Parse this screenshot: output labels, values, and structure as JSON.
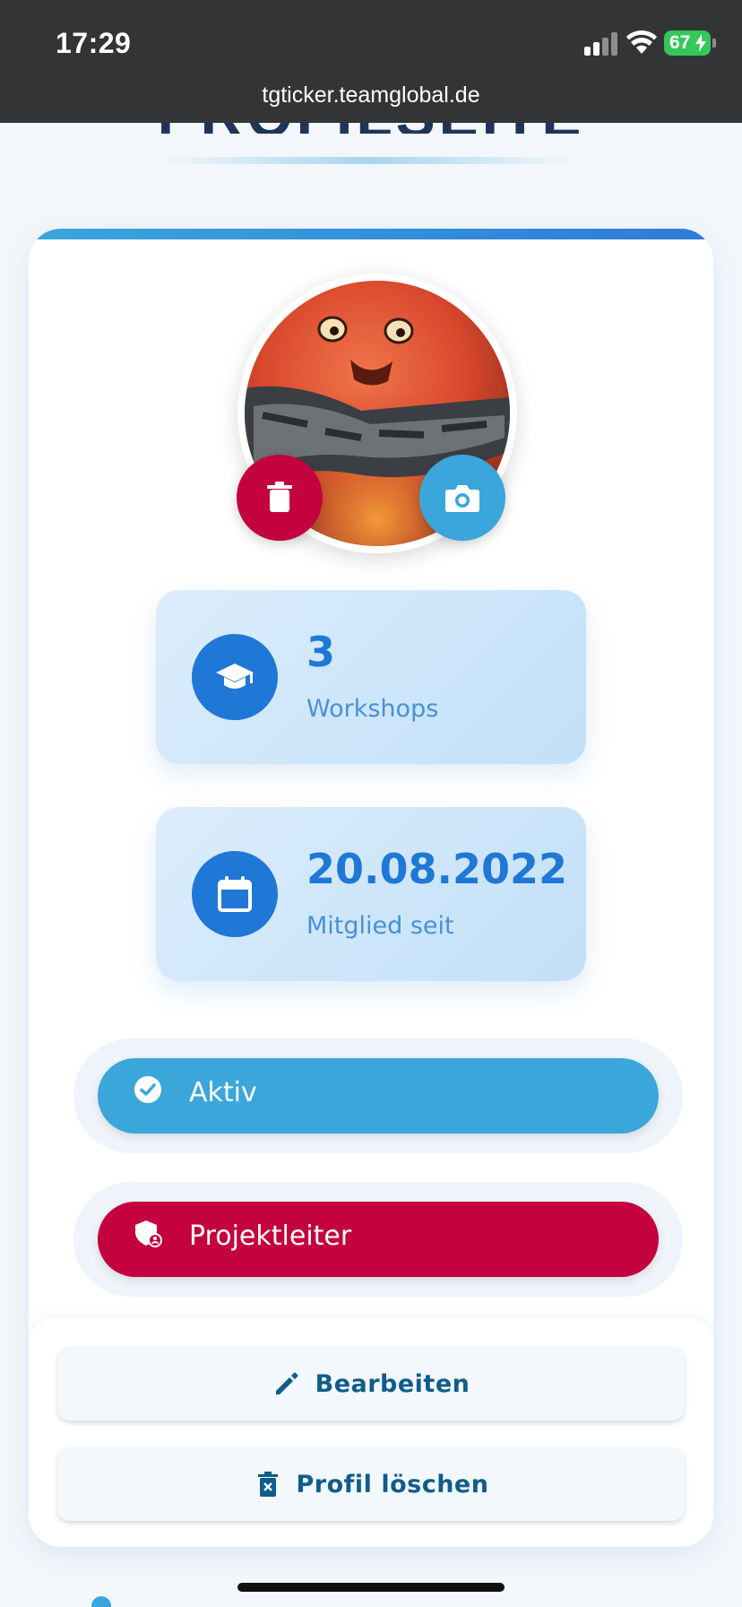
{
  "status_bar": {
    "time": "17:29",
    "battery": "67",
    "url": "tgticker.teamglobal.de"
  },
  "page": {
    "title": "PROFILSEITE"
  },
  "profile": {
    "avatar_alt": "Profilbild",
    "delete_photo_icon": "trash-icon",
    "change_photo_icon": "camera-icon"
  },
  "stats": [
    {
      "icon": "graduation-cap-icon",
      "value": "3",
      "label": "Workshops"
    },
    {
      "icon": "calendar-icon",
      "value": "20.08.2022",
      "label": "Mitglied seit"
    }
  ],
  "badges": {
    "status": {
      "icon": "check-circle-icon",
      "label": "Aktiv",
      "color": "#3ba6da"
    },
    "role": {
      "icon": "admin-shield-icon",
      "label": "Projektleiter",
      "color": "#c4023f"
    }
  },
  "actions": {
    "edit_label": "Bearbeiten",
    "delete_label": "Profil löschen"
  },
  "colors": {
    "primary": "#1f77d6",
    "accent": "#3aa6dc",
    "danger": "#c4023f",
    "button_text": "#0f5d8a"
  }
}
